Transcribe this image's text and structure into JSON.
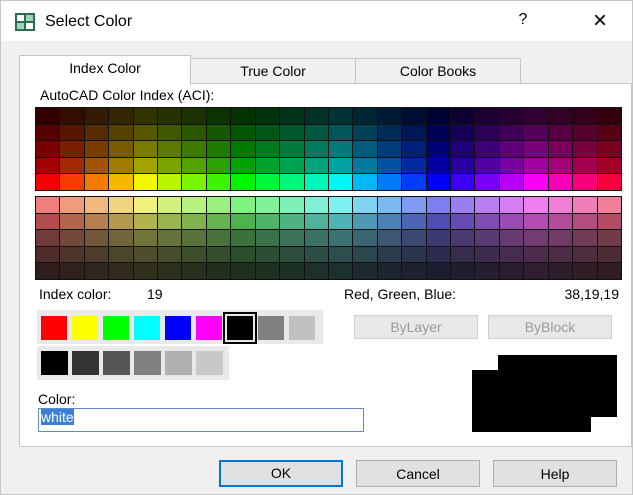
{
  "window": {
    "title": "Select Color",
    "help_glyph": "?",
    "close_glyph": "×"
  },
  "tabs": [
    {
      "label": "Index Color",
      "active": true
    },
    {
      "label": "True Color",
      "active": false
    },
    {
      "label": "Color Books",
      "active": false
    }
  ],
  "aci": {
    "heading": "AutoCAD Color Index (ACI):",
    "top_palette_hues": [
      0,
      15,
      30,
      45,
      60,
      75,
      90,
      105,
      120,
      135,
      150,
      165,
      180,
      195,
      210,
      225,
      240,
      255,
      270,
      285,
      300,
      315,
      330,
      345
    ],
    "top_palette_shades": 5,
    "bottom_palette_shades": 5
  },
  "index_color": {
    "label": "Index color:",
    "value": "19"
  },
  "rgb": {
    "label": "Red, Green, Blue:",
    "value": "38,19,19"
  },
  "standard_colors": [
    "#ff0000",
    "#ffff00",
    "#00ff00",
    "#00ffff",
    "#0000ff",
    "#ff00ff",
    "#000000",
    "#808080",
    "#c0c0c0"
  ],
  "selected_standard_index": 6,
  "gray_colors": [
    "#000000",
    "#333333",
    "#555555",
    "#808080",
    "#b0b0b0",
    "#c8c8c8"
  ],
  "bylayer_label": "ByLayer",
  "byblock_label": "ByBlock",
  "color_field": {
    "label": "Color:",
    "value": "white"
  },
  "preview": {
    "previous_color": "#000000",
    "new_color": "#000000"
  },
  "buttons": {
    "ok": "OK",
    "cancel": "Cancel",
    "help": "Help"
  }
}
